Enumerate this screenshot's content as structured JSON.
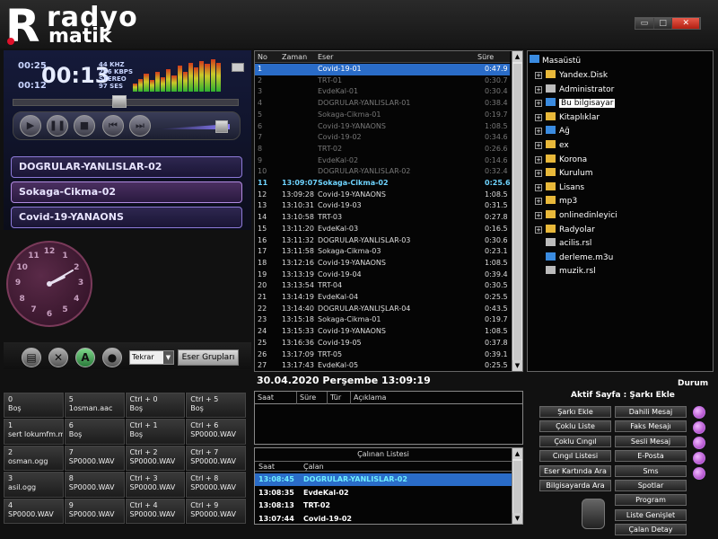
{
  "app": {
    "logo_main": "radyo",
    "logo_sub": "matik",
    "logo_letter": "R"
  },
  "window_controls": {
    "minimize": "▭",
    "maximize": "□",
    "close": "✕"
  },
  "player": {
    "elapsed_small": "00:25",
    "remaining_small": "00:12",
    "time_big": "00:13",
    "freq": "44 KHZ",
    "bitrate": "256 KBPS",
    "mode": "STEREO",
    "volume_label": "97 SES",
    "seek_fraction": 0.47,
    "volume_fraction": 0.9,
    "vu_levels": [
      0.25,
      0.4,
      0.55,
      0.35,
      0.6,
      0.45,
      0.7,
      0.5,
      0.8,
      0.6,
      0.9,
      0.75,
      0.95,
      0.85,
      1.0,
      0.9
    ]
  },
  "controls": {
    "play_icon": "play-icon",
    "pause_icon": "pause-icon",
    "stop_icon": "stop-icon",
    "prev_icon": "prev-icon",
    "next_icon": "next-icon"
  },
  "queue": [
    {
      "label": "DOGRULAR-YANLISLAR-02"
    },
    {
      "label": "Sokaga-Cikma-02"
    },
    {
      "label": "Covid-19-YANAONS"
    }
  ],
  "clock": {
    "hour": 2,
    "minute": 10
  },
  "toolbar": {
    "repeat_value": "Tekrar",
    "groups_button": "Eser Grupları",
    "icon_doc": "document-icon",
    "icon_tools": "tools-icon",
    "icon_a": "A",
    "icon_lock": "lock-icon"
  },
  "hotkeys": [
    {
      "key": "0",
      "value": "Boş"
    },
    {
      "key": "5",
      "value": "1osman.aac"
    },
    {
      "key": "Ctrl + 0",
      "value": "Boş"
    },
    {
      "key": "Ctrl + 5",
      "value": "Boş"
    },
    {
      "key": "1",
      "value": "sert lokumfm.mp3"
    },
    {
      "key": "6",
      "value": "Boş"
    },
    {
      "key": "Ctrl + 1",
      "value": "Boş"
    },
    {
      "key": "Ctrl + 6",
      "value": "SP0000.WAV"
    },
    {
      "key": "2",
      "value": "osman.ogg"
    },
    {
      "key": "7",
      "value": "SP0000.WAV"
    },
    {
      "key": "Ctrl + 2",
      "value": "SP0000.WAV"
    },
    {
      "key": "Ctrl + 7",
      "value": "SP0000.WAV"
    },
    {
      "key": "3",
      "value": "asil.ogg"
    },
    {
      "key": "8",
      "value": "SP0000.WAV"
    },
    {
      "key": "Ctrl + 3",
      "value": "SP0000.WAV"
    },
    {
      "key": "Ctrl + 8",
      "value": "SP0000.WAV"
    },
    {
      "key": "4",
      "value": "SP0000.WAV"
    },
    {
      "key": "9",
      "value": "SP0000.WAV"
    },
    {
      "key": "Ctrl + 4",
      "value": "SP0000.WAV"
    },
    {
      "key": "Ctrl + 9",
      "value": "SP0000.WAV"
    }
  ],
  "playlist": {
    "headers": {
      "no": "No",
      "time": "Zaman",
      "title": "Eser",
      "duration": "Süre"
    },
    "rows": [
      {
        "no": "1",
        "time": "",
        "title": "Covid-19-01",
        "duration": "0:47.9",
        "state": "sel"
      },
      {
        "no": "2",
        "time": "",
        "title": "TRT-01",
        "duration": "0:30.7",
        "state": "played"
      },
      {
        "no": "3",
        "time": "",
        "title": "EvdeKal-01",
        "duration": "0:30.4",
        "state": "played"
      },
      {
        "no": "4",
        "time": "",
        "title": "DOGRULAR-YANLISLAR-01",
        "duration": "0:38.4",
        "state": "played"
      },
      {
        "no": "5",
        "time": "",
        "title": "Sokaga-Cikma-01",
        "duration": "0:19.7",
        "state": "played"
      },
      {
        "no": "6",
        "time": "",
        "title": "Covid-19-YANAONS",
        "duration": "1:08.5",
        "state": "played"
      },
      {
        "no": "7",
        "time": "",
        "title": "Covid-19-02",
        "duration": "0:34.6",
        "state": "played"
      },
      {
        "no": "8",
        "time": "",
        "title": "TRT-02",
        "duration": "0:26.6",
        "state": "played"
      },
      {
        "no": "9",
        "time": "",
        "title": "EvdeKal-02",
        "duration": "0:14.6",
        "state": "played"
      },
      {
        "no": "10",
        "time": "",
        "title": "DOGRULAR-YANLISLAR-02",
        "duration": "0:32.4",
        "state": "played"
      },
      {
        "no": "11",
        "time": "13:09:07",
        "title": "Sokaga-Cikma-02",
        "duration": "0:25.6",
        "state": "cur"
      },
      {
        "no": "12",
        "time": "13:09:28",
        "title": "Covid-19-YANAONS",
        "duration": "1:08.5",
        "state": ""
      },
      {
        "no": "13",
        "time": "13:10:31",
        "title": "Covid-19-03",
        "duration": "0:31.5",
        "state": ""
      },
      {
        "no": "14",
        "time": "13:10:58",
        "title": "TRT-03",
        "duration": "0:27.8",
        "state": ""
      },
      {
        "no": "15",
        "time": "13:11:20",
        "title": "EvdeKal-03",
        "duration": "0:16.5",
        "state": ""
      },
      {
        "no": "16",
        "time": "13:11:32",
        "title": "DOGRULAR-YANLISLAR-03",
        "duration": "0:30.6",
        "state": ""
      },
      {
        "no": "17",
        "time": "13:11:58",
        "title": "Sokaga-Cikma-03",
        "duration": "0:23.1",
        "state": ""
      },
      {
        "no": "18",
        "time": "13:12:16",
        "title": "Covid-19-YANAONS",
        "duration": "1:08.5",
        "state": ""
      },
      {
        "no": "19",
        "time": "13:13:19",
        "title": "Covid-19-04",
        "duration": "0:39.4",
        "state": ""
      },
      {
        "no": "20",
        "time": "13:13:54",
        "title": "TRT-04",
        "duration": "0:30.5",
        "state": ""
      },
      {
        "no": "21",
        "time": "13:14:19",
        "title": "EvdeKal-04",
        "duration": "0:25.5",
        "state": ""
      },
      {
        "no": "22",
        "time": "13:14:40",
        "title": "DOGRULAR-YANLIŞLAR-04",
        "duration": "0:43.5",
        "state": ""
      },
      {
        "no": "23",
        "time": "13:15:18",
        "title": "Sokaga-Cikma-01",
        "duration": "0:19.7",
        "state": ""
      },
      {
        "no": "24",
        "time": "13:15:33",
        "title": "Covid-19-YANAONS",
        "duration": "1:08.5",
        "state": ""
      },
      {
        "no": "25",
        "time": "13:16:36",
        "title": "Covid-19-05",
        "duration": "0:37.8",
        "state": ""
      },
      {
        "no": "26",
        "time": "13:17:09",
        "title": "TRT-05",
        "duration": "0:39.1",
        "state": ""
      },
      {
        "no": "27",
        "time": "13:17:43",
        "title": "EvdeKal-05",
        "duration": "0:25.5",
        "state": ""
      }
    ]
  },
  "tree": {
    "root": "Masaüstü",
    "items": [
      {
        "label": "Yandex.Disk",
        "icon": "folder",
        "expand": true,
        "sel": false
      },
      {
        "label": "Administrator",
        "icon": "gray",
        "expand": true,
        "sel": false
      },
      {
        "label": "Bu bilgisayar",
        "icon": "blue",
        "expand": true,
        "sel": true
      },
      {
        "label": "Kitaplıklar",
        "icon": "folder",
        "expand": true,
        "sel": false
      },
      {
        "label": "Ağ",
        "icon": "blue",
        "expand": true,
        "sel": false
      },
      {
        "label": "ex",
        "icon": "folder",
        "expand": true,
        "sel": false
      },
      {
        "label": "Korona",
        "icon": "folder",
        "expand": true,
        "sel": false
      },
      {
        "label": "Kurulum",
        "icon": "folder",
        "expand": true,
        "sel": false
      },
      {
        "label": "Lisans",
        "icon": "folder",
        "expand": true,
        "sel": false
      },
      {
        "label": "mp3",
        "icon": "folder",
        "expand": true,
        "sel": false
      },
      {
        "label": "onlinedinleyici",
        "icon": "folder",
        "expand": true,
        "sel": false
      },
      {
        "label": "Radyolar",
        "icon": "folder",
        "expand": true,
        "sel": false
      },
      {
        "label": "acilis.rsl",
        "icon": "gray",
        "expand": false,
        "sel": false
      },
      {
        "label": "derleme.m3u",
        "icon": "blue",
        "expand": false,
        "sel": false
      },
      {
        "label": "muzik.rsl",
        "icon": "gray",
        "expand": false,
        "sel": false
      }
    ]
  },
  "date_label": "30.04.2020 Perşembe 13:09:19",
  "log": {
    "headers": [
      "Saat",
      "Süre",
      "Tür",
      "Açıklama"
    ]
  },
  "played": {
    "title": "Çalınan Listesi",
    "headers": {
      "time": "Saat",
      "title": "Çalan"
    },
    "rows": [
      {
        "time": "13:08:45",
        "title": "DOGRULAR-YANLISLAR-02",
        "sel": true
      },
      {
        "time": "13:08:35",
        "title": "EvdeKal-02",
        "sel": false
      },
      {
        "time": "13:08:13",
        "title": "TRT-02",
        "sel": false
      },
      {
        "time": "13:07:44",
        "title": "Covid-19-02",
        "sel": false
      }
    ]
  },
  "right_panel": {
    "durum": "Durum",
    "active_page": "Aktif Sayfa : Şarkı Ekle",
    "left_buttons": [
      "Şarkı Ekle",
      "Çoklu Liste",
      "Çoklu Cıngıl",
      "Cıngıl Listesi",
      "Eser Kartında Ara",
      "Bilgisayarda Ara"
    ],
    "right_buttons": [
      "Dahili Mesaj",
      "Faks Mesajı",
      "Sesli Mesaj",
      "E-Posta",
      "Sms",
      "Spotlar",
      "Program",
      "Liste Genişlet",
      "Çalan Detay"
    ]
  }
}
